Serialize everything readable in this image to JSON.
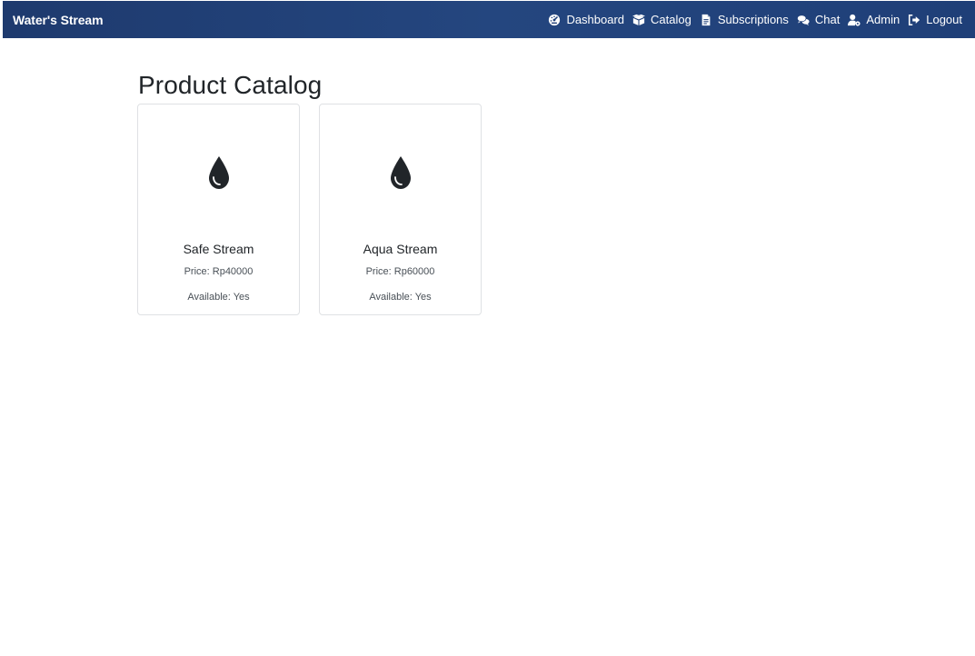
{
  "navbar": {
    "brand": "Water's Stream",
    "links": [
      {
        "label": "Dashboard",
        "icon": "dashboard-gauge-icon"
      },
      {
        "label": "Catalog",
        "icon": "catalog-box-icon"
      },
      {
        "label": "Subscriptions",
        "icon": "document-icon"
      },
      {
        "label": "Chat",
        "icon": "chat-bubbles-icon"
      },
      {
        "label": "Admin",
        "icon": "user-gear-icon"
      },
      {
        "label": "Logout",
        "icon": "logout-icon"
      }
    ],
    "colors": {
      "background": "#1f3f78",
      "text": "#ffffff"
    }
  },
  "main": {
    "title": "Product Catalog",
    "products": [
      {
        "name": "Safe Stream",
        "price": "Price: Rp40000",
        "available": "Available: Yes",
        "icon": "water-drop-icon"
      },
      {
        "name": "Aqua Stream",
        "price": "Price: Rp60000",
        "available": "Available: Yes",
        "icon": "water-drop-icon"
      }
    ]
  }
}
